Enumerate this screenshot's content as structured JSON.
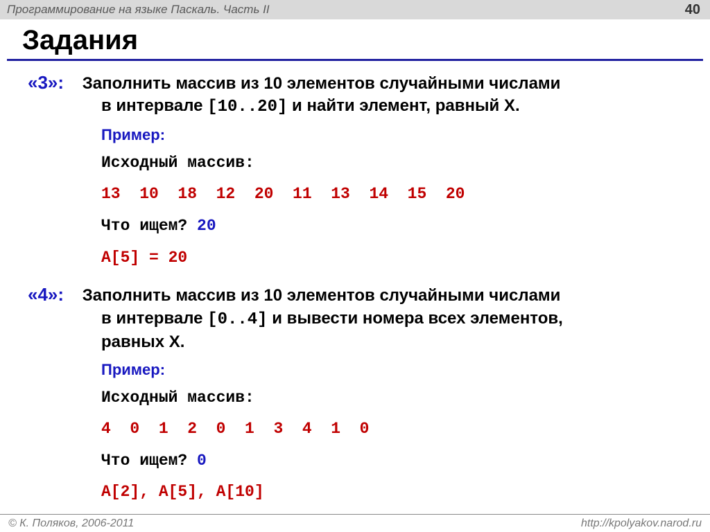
{
  "header": {
    "course": "Программирование на языке Паскаль. Часть II",
    "page": "40"
  },
  "title": "Задания",
  "tasks": [
    {
      "grade": "«3»:",
      "desc_line1": "Заполнить массив из 10 элементов случайными числами",
      "desc_line2_a": "в интервале ",
      "desc_line2_mono": "[10..20]",
      "desc_line2_b": " и найти элемент, равный X.",
      "example_label": "Пример:",
      "src_label": "Исходный массив:",
      "array": "13  10  18  12  20  11  13  14  15  20",
      "prompt_label": "Что ищем? ",
      "prompt_value": "20",
      "result": "A[5] = 20"
    },
    {
      "grade": "«4»:",
      "desc_line1": "Заполнить массив из 10 элементов случайными числами",
      "desc_line2_a": "в интервале ",
      "desc_line2_mono": "[0..4]",
      "desc_line2_b": " и вывести номера всех элементов,",
      "desc_line3": "равных X.",
      "example_label": "Пример:",
      "src_label": "Исходный массив:",
      "array": "4  0  1  2  0  1  3  4  1  0",
      "prompt_label": "Что ищем? ",
      "prompt_value": "0",
      "result": "A[2], A[5], A[10]"
    }
  ],
  "footer": {
    "copyright": "© К. Поляков, 2006-2011",
    "url": "http://kpolyakov.narod.ru"
  }
}
